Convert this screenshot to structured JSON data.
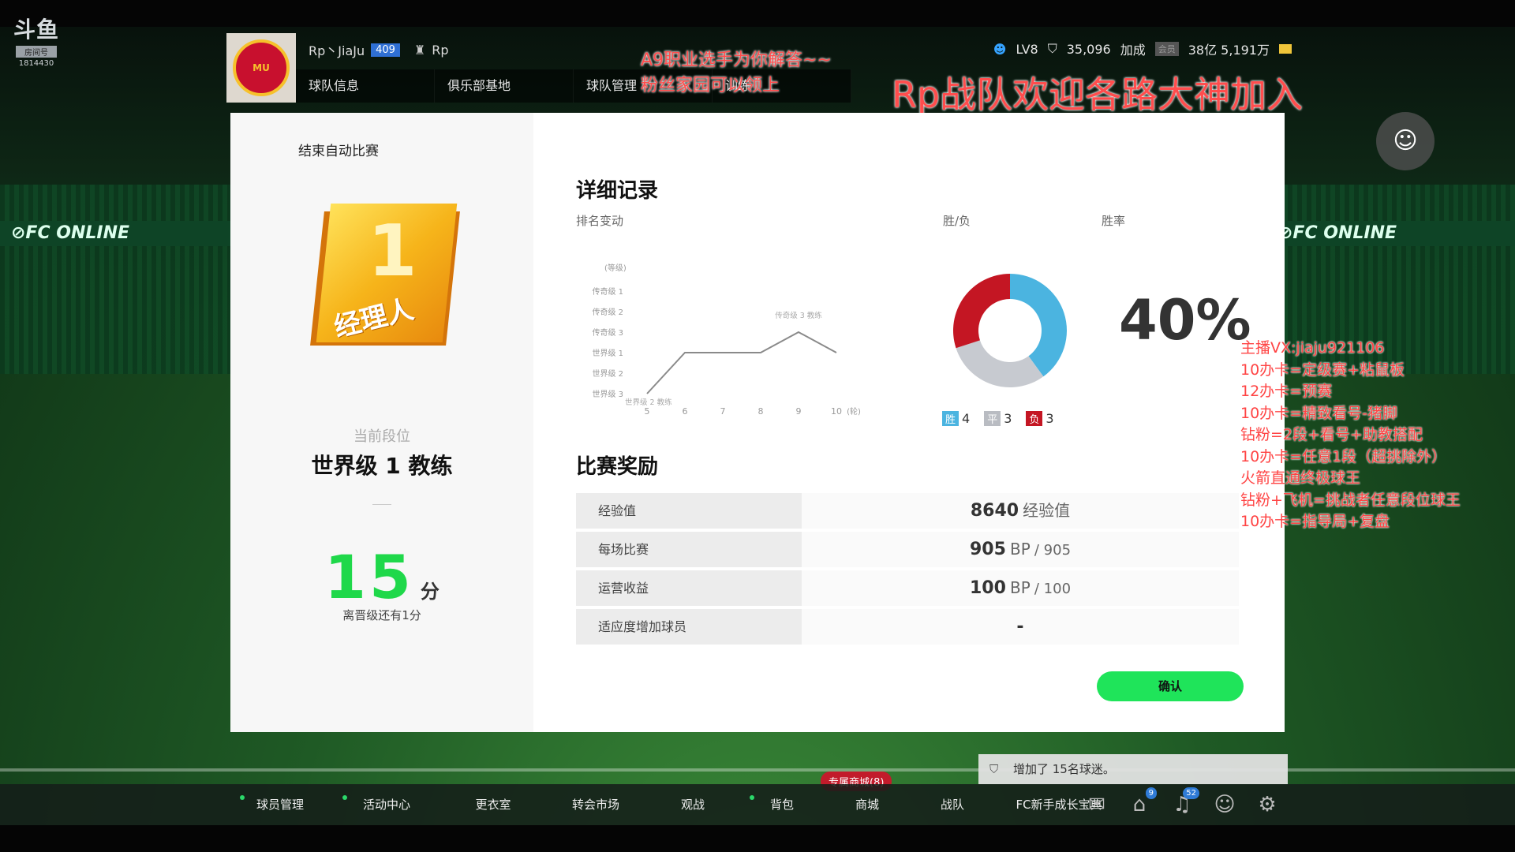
{
  "watermark": {
    "brand": "斗鱼",
    "room_label": "房间号",
    "room_id": "1814430"
  },
  "header": {
    "player_name": "Rp丶JiaJu",
    "level_badge": "409",
    "team_name": "Rp",
    "nav": [
      "球队信息",
      "俱乐部基地",
      "球队管理",
      "训练"
    ],
    "manager_level": "LV8",
    "fans": "35,096",
    "boost_label": "加成",
    "member_tag": "会员",
    "bp": "38亿 5,191万"
  },
  "overlays": {
    "line1": "A9职业选手为你解答~~",
    "line2": "粉丝家园可以领上",
    "line3": "Rp战队欢迎各路大神加入",
    "side_list": [
      "主播VX:jiaju921106",
      "10办卡=定级赛+粘鼠板",
      "12办卡=预赛",
      "10办卡=精致看号-猪脚",
      "钻粉=2段+看号+助教搭配",
      "10办卡=任意1段（超挑除外）",
      "火箭直通终极球王",
      "钻粉+飞机=挑战者任意段位球王",
      "10办卡=指导局+复盘"
    ]
  },
  "modal": {
    "title": "结束自动比赛",
    "badge_number": "1",
    "badge_label": "经理人",
    "current_rank_label": "当前段位",
    "current_rank": "世界级 1 教练",
    "points": "15",
    "points_unit": "分",
    "promo_note": "离晋级还有1分",
    "detail_title": "详细记录",
    "rank_change_label": "排名变动",
    "win_loss_label": "胜/负",
    "win_rate_label": "胜率",
    "win_rate": "40%",
    "legend": {
      "win_label": "胜",
      "wins": "4",
      "draw_label": "平",
      "draws": "3",
      "loss_label": "负",
      "losses": "3"
    },
    "reward_title": "比赛奖励",
    "rewards": [
      {
        "label": "经验值",
        "value": "8640",
        "unit": "经验值",
        "max": ""
      },
      {
        "label": "每场比赛",
        "value": "905",
        "unit": "BP",
        "max": "/ 905"
      },
      {
        "label": "运营收益",
        "value": "100",
        "unit": "BP",
        "max": "/ 100"
      },
      {
        "label": "适应度增加球员",
        "value": "-",
        "unit": "",
        "max": ""
      }
    ],
    "confirm_label": "确认"
  },
  "chart_data": {
    "type": "line",
    "title": "",
    "ylabel": "(等级)",
    "xlabel": "(轮)",
    "y_categories": [
      "传奇级 1",
      "传奇级 2",
      "传奇级 3",
      "世界级 1",
      "世界级 2",
      "世界级 3"
    ],
    "x": [
      5,
      6,
      7,
      8,
      9,
      10
    ],
    "x_tick_labels": [
      "5",
      "6",
      "7",
      "8",
      "9",
      "10"
    ],
    "series": [
      {
        "values": [
          "世界级 3",
          "世界级 1",
          "世界级 1",
          "世界级 1",
          "传奇级 3",
          "世界级 1"
        ]
      }
    ],
    "annotations": [
      {
        "x": 5,
        "text": "世界级 2 教练"
      },
      {
        "x": 9,
        "text": "传奇级 3 教练"
      }
    ],
    "colors": {
      "line": "#8a8a8a"
    }
  },
  "donut_data": {
    "type": "pie",
    "categories": [
      "胜",
      "平",
      "负"
    ],
    "values": [
      4,
      3,
      3
    ],
    "colors": [
      "#4bb4e0",
      "#c7cad0",
      "#c41623"
    ]
  },
  "toast": {
    "text": "增加了 15名球迷。"
  },
  "bottom": {
    "shop_tag": "专属商城(8)",
    "nav": [
      "球员管理",
      "活动中心",
      "更衣室",
      "转会市场",
      "观战",
      "背包",
      "商城",
      "战队",
      "FC新手成长宝典"
    ],
    "badge_home": "9",
    "badge_bell": "52"
  }
}
